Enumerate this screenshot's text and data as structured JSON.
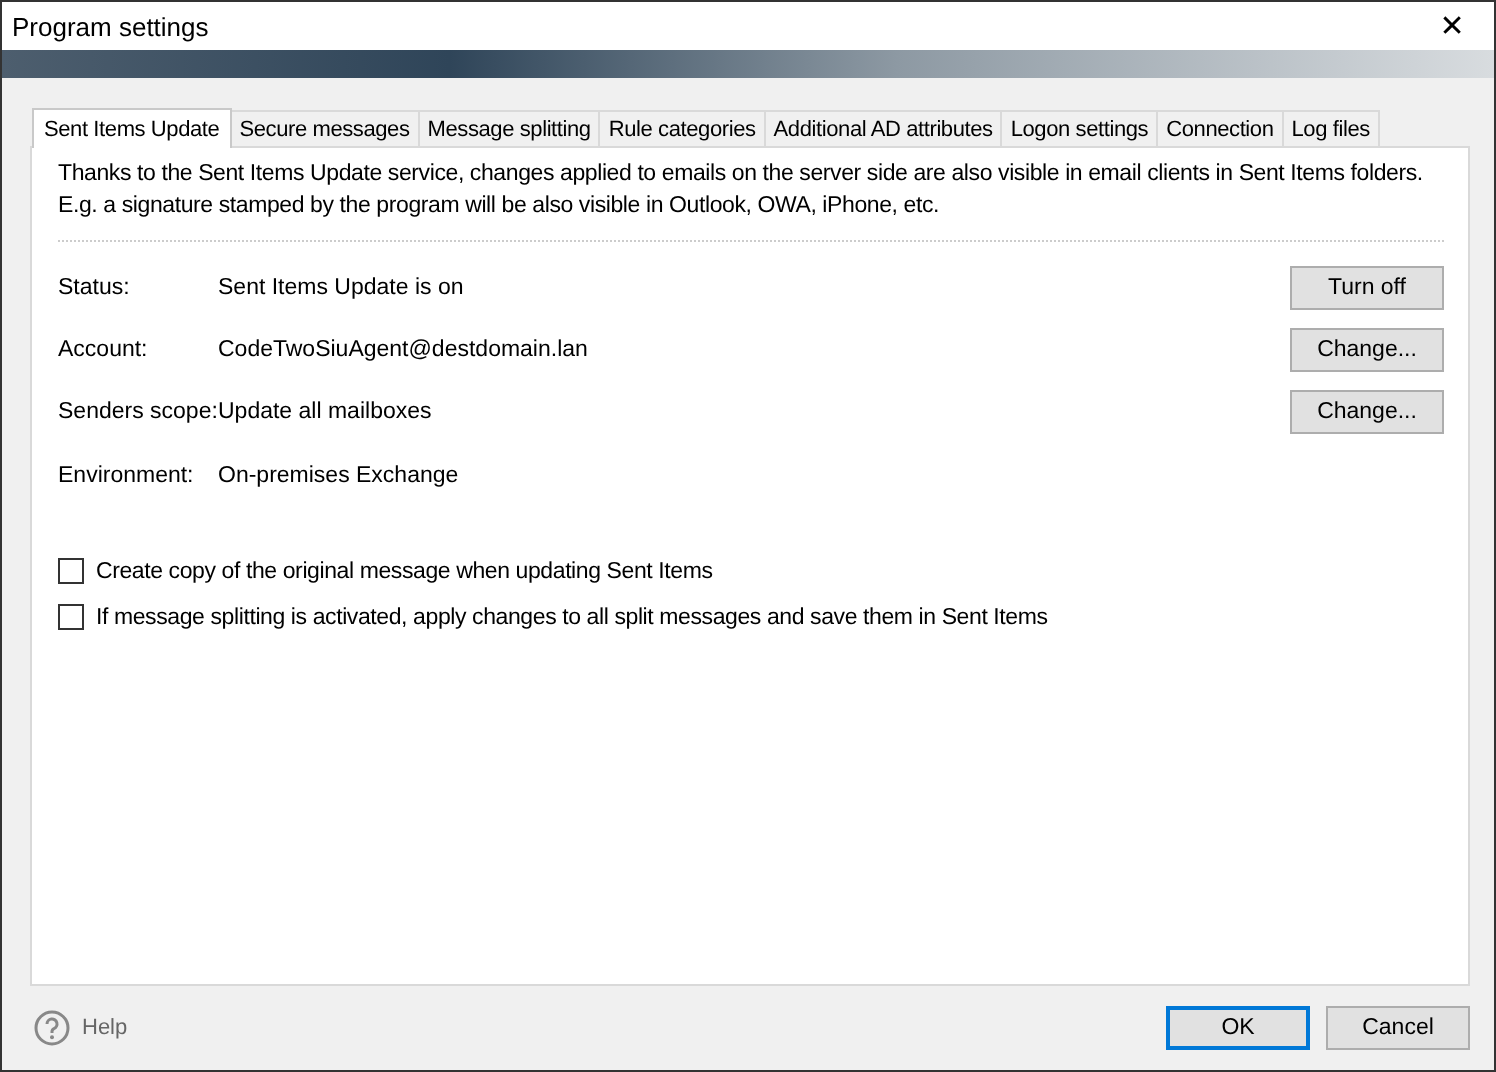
{
  "window": {
    "title": "Program settings",
    "close": "✕"
  },
  "tabs": [
    {
      "label": "Sent Items Update",
      "selected": true
    },
    {
      "label": "Secure messages",
      "selected": false
    },
    {
      "label": "Message splitting",
      "selected": false
    },
    {
      "label": "Rule categories",
      "selected": false
    },
    {
      "label": "Additional AD attributes",
      "selected": false
    },
    {
      "label": "Logon settings",
      "selected": false
    },
    {
      "label": "Connection",
      "selected": false
    },
    {
      "label": "Log files",
      "selected": false
    }
  ],
  "description": "Thanks to the Sent Items Update service, changes applied to emails on the server side are also visible in email clients in Sent Items folders. E.g. a signature stamped by the program will be also visible in Outlook, OWA, iPhone, etc.",
  "fields": [
    {
      "label": "Status:",
      "value": "Sent Items Update is on",
      "button": "Turn off"
    },
    {
      "label": "Account:",
      "value": "CodeTwoSiuAgent@destdomain.lan",
      "button": "Change..."
    },
    {
      "label": "Senders scope:",
      "value": "Update all mailboxes",
      "button": "Change..."
    },
    {
      "label": "Environment:",
      "value": "On-premises Exchange"
    }
  ],
  "options": [
    {
      "label": "Create copy of the original message when updating Sent Items",
      "checked": false
    },
    {
      "label": "If message splitting is activated, apply changes to all split messages and save them in Sent Items",
      "checked": false
    }
  ],
  "footer": {
    "help": "Help",
    "buttons": [
      {
        "label": "OK",
        "default": true
      },
      {
        "label": "Cancel",
        "default": false
      }
    ]
  }
}
